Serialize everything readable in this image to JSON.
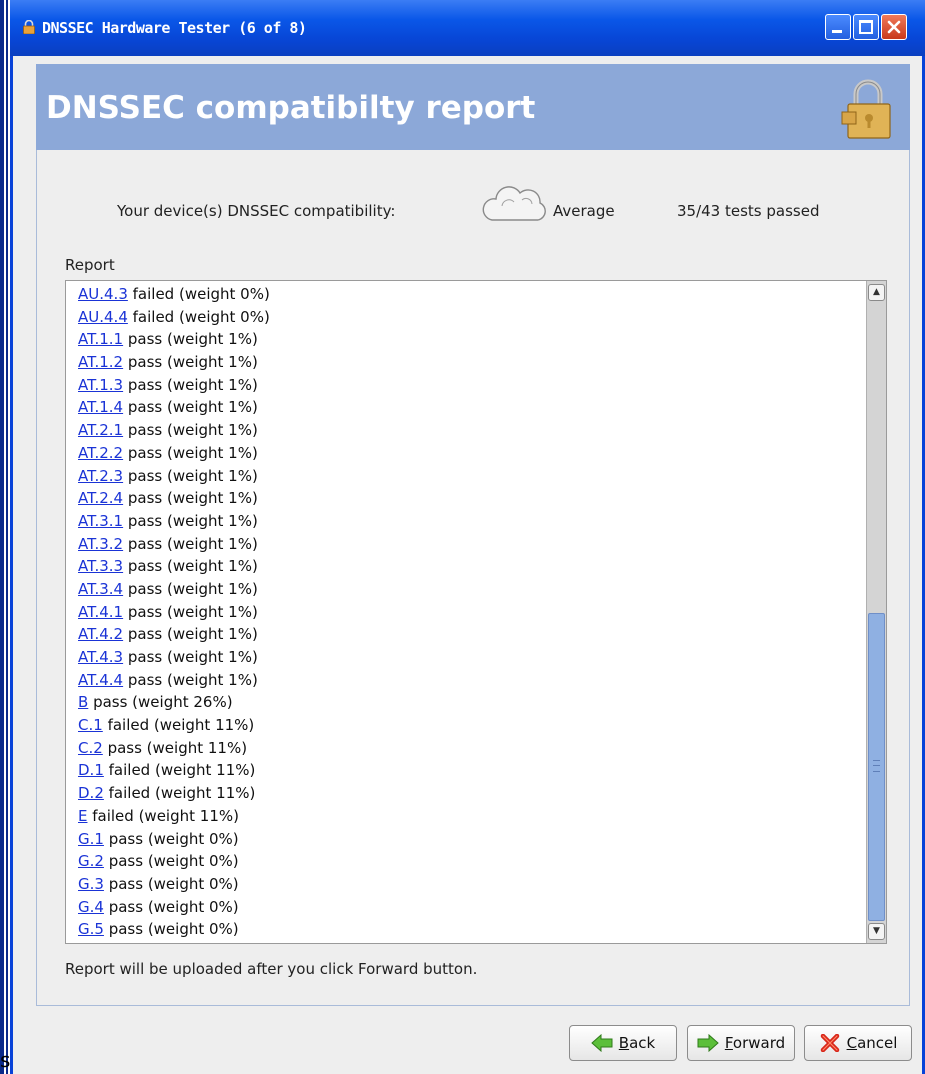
{
  "window": {
    "title": "DNSSEC Hardware Tester (6 of 8)"
  },
  "header": {
    "title": "DNSSEC compatibilty report",
    "icon": "padlock-icon"
  },
  "summary": {
    "label": "Your device(s) DNSSEC compatibility:",
    "icon": "cloud-icon",
    "value": "Average",
    "tests": "35/43 tests passed"
  },
  "report": {
    "label": "Report",
    "lines": [
      {
        "id": "AU.4.3",
        "text": " failed (weight 0%)"
      },
      {
        "id": "AU.4.4",
        "text": " failed (weight 0%)"
      },
      {
        "id": "AT.1.1",
        "text": " pass (weight 1%)"
      },
      {
        "id": "AT.1.2",
        "text": " pass (weight 1%)"
      },
      {
        "id": "AT.1.3",
        "text": " pass (weight 1%)"
      },
      {
        "id": "AT.1.4",
        "text": " pass (weight 1%)"
      },
      {
        "id": "AT.2.1",
        "text": " pass (weight 1%)"
      },
      {
        "id": "AT.2.2",
        "text": " pass (weight 1%)"
      },
      {
        "id": "AT.2.3",
        "text": " pass (weight 1%)"
      },
      {
        "id": "AT.2.4",
        "text": " pass (weight 1%)"
      },
      {
        "id": "AT.3.1",
        "text": " pass (weight 1%)"
      },
      {
        "id": "AT.3.2",
        "text": " pass (weight 1%)"
      },
      {
        "id": "AT.3.3",
        "text": " pass (weight 1%)"
      },
      {
        "id": "AT.3.4",
        "text": " pass (weight 1%)"
      },
      {
        "id": "AT.4.1",
        "text": " pass (weight 1%)"
      },
      {
        "id": "AT.4.2",
        "text": " pass (weight 1%)"
      },
      {
        "id": "AT.4.3",
        "text": " pass (weight 1%)"
      },
      {
        "id": "AT.4.4",
        "text": " pass (weight 1%)"
      },
      {
        "id": "B",
        "text": " pass (weight 26%)"
      },
      {
        "id": "C.1",
        "text": " failed (weight 11%)"
      },
      {
        "id": "C.2",
        "text": " pass (weight 11%)"
      },
      {
        "id": "D.1",
        "text": " failed (weight 11%)"
      },
      {
        "id": "D.2",
        "text": " failed (weight 11%)"
      },
      {
        "id": "E",
        "text": " failed (weight 11%)"
      },
      {
        "id": "G.1",
        "text": " pass (weight 0%)"
      },
      {
        "id": "G.2",
        "text": " pass (weight 0%)"
      },
      {
        "id": "G.3",
        "text": " pass (weight 0%)"
      },
      {
        "id": "G.4",
        "text": " pass (weight 0%)"
      },
      {
        "id": "G.5",
        "text": " pass (weight 0%)"
      }
    ]
  },
  "footer_note": "Report will be uploaded after you click Forward button.",
  "buttons": {
    "back": {
      "first": "B",
      "rest": "ack",
      "icon": "arrow-left-icon"
    },
    "forward": {
      "first": "F",
      "rest": "orward",
      "icon": "arrow-right-icon"
    },
    "cancel": {
      "first": "C",
      "rest": "ancel",
      "icon": "red-x-icon"
    }
  },
  "background_fragment": "s",
  "colors": {
    "titlebar": "#0a57e8",
    "header": "#8ca8d8",
    "link": "#1a33d6",
    "scroll_thumb": "#8fb0e2"
  }
}
